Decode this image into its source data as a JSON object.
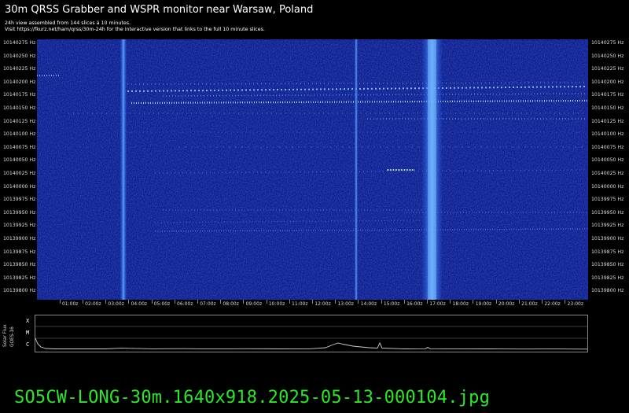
{
  "header": {
    "title": "30m QRSS Grabber and WSPR monitor near Warsaw, Poland",
    "line1": "24h view assembled from 144 slices á 10 minutes.",
    "line2": "Visit https://fkurz.net/ham/qrss/30m-24h for the interactive version that links to the full 10 minute slices."
  },
  "yaxis": {
    "unit": "Hz",
    "labels": [
      "10140275 Hz",
      "10140250 Hz",
      "10140225 Hz",
      "10140200 Hz",
      "10140175 Hz",
      "10140150 Hz",
      "10140125 Hz",
      "10140100 Hz",
      "10140075 Hz",
      "10140050 Hz",
      "10140025 Hz",
      "10140000 Hz",
      "10139975 Hz",
      "10139950 Hz",
      "10139925 Hz",
      "10139900 Hz",
      "10139875 Hz",
      "10139850 Hz",
      "10139825 Hz",
      "10139800 Hz"
    ]
  },
  "xaxis": {
    "labels": [
      "01:00z",
      "02:00z",
      "03:00z",
      "04:00z",
      "05:00z",
      "06:00z",
      "07:00z",
      "08:00z",
      "09:00z",
      "10:00z",
      "11:00z",
      "12:00z",
      "13:00z",
      "14:00z",
      "15:00z",
      "16:00z",
      "17:00z",
      "18:00z",
      "19:00z",
      "20:00z",
      "21:00z",
      "22:00z",
      "23:00z"
    ]
  },
  "solar_flux": {
    "title": "Solar Flux",
    "source": "GOES-16",
    "classes": [
      "X",
      "M",
      "C"
    ]
  },
  "footer": {
    "filename": "SO5CW-LONG-30m.1640x918.2025-05-13-000104.jpg"
  },
  "colors": {
    "background": "#000000",
    "waterfall_base": "#0c1a8c",
    "footer_text": "#29e829",
    "trace": "#cccccc"
  }
}
